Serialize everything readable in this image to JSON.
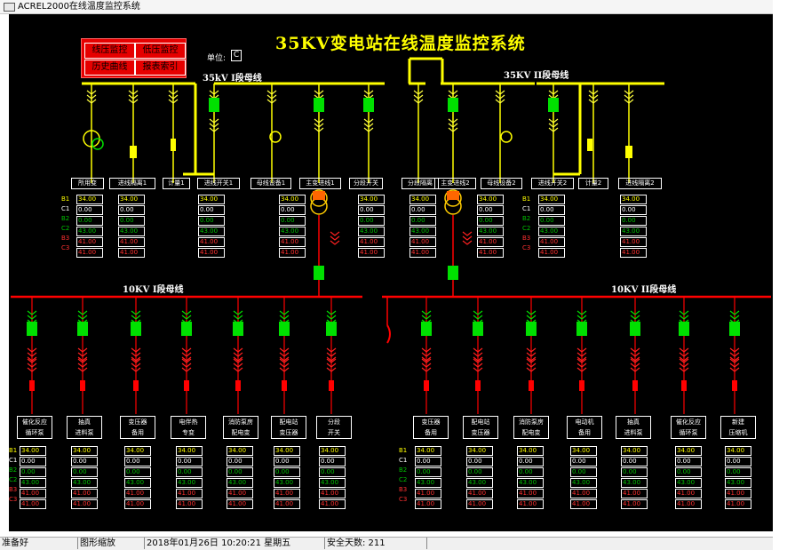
{
  "window": {
    "title": "ACREL2000在线温度监控系统"
  },
  "header": {
    "title": "35KV变电站在线温度监控系统",
    "unit_label": "单位:",
    "unit_value": "C",
    "buttons": [
      "线压监控",
      "低压监控",
      "历史曲线",
      "报表索引"
    ]
  },
  "buses": {
    "hv1": "35kV I段母线",
    "hv2": "35KV II段母线",
    "lv1": "10KV I段母线",
    "lv2": "10KV II段母线"
  },
  "hv_feeders": [
    "所用变",
    "进线隔离1",
    "计量1",
    "进线开关1",
    "母线设备1",
    "主变进线1",
    "分段开关",
    "分段隔离",
    "主变进线2",
    "母线设备2",
    "进线开关2",
    "计量2",
    "进线隔离2"
  ],
  "lv_feeders": [
    [
      "催化反应",
      "循环泵"
    ],
    [
      "抽真",
      "进料泵"
    ],
    [
      "变压器",
      "备用"
    ],
    [
      "电伴热",
      "专变"
    ],
    [
      "消防泵房",
      "配电变"
    ],
    [
      "配电站",
      "变压器"
    ],
    [
      "分段",
      "开关"
    ],
    [
      "变压器",
      "备用"
    ],
    [
      "配电站",
      "变压器"
    ],
    [
      "消防泵房",
      "配电变"
    ],
    [
      "电动机",
      "备用"
    ],
    [
      "抽真",
      "进料泵"
    ],
    [
      "催化反应",
      "循环泵"
    ],
    [
      "新建",
      "压缩机"
    ]
  ],
  "row_labels": [
    "B1",
    "C1",
    "B2",
    "C2",
    "B3",
    "C3"
  ],
  "readings": [
    "34.00",
    "0.00",
    "0.00",
    "43.00",
    "41.00",
    "41.00"
  ],
  "readings_hv": {
    "col2": [
      "34.00",
      "0.00",
      "0.00",
      "43.00",
      "41.00",
      "41.00"
    ],
    "col3": [
      "34.00",
      "0.00",
      "0.00",
      "43.00",
      "41.00",
      "41.00"
    ],
    "col5": [
      "34.00",
      "0.00",
      "0.00",
      "43.00",
      "41.00",
      "41.00"
    ]
  },
  "status": {
    "ready": "准备好",
    "zoom": "图形缩放",
    "datetime": "2018年01月26日   10:20:21   星期五",
    "safe_days": "安全天数: 211"
  },
  "colors": {
    "hv": "#ffff00",
    "lv": "#ff0000",
    "breaker": "#00e000",
    "reading_b1": "#ffff00",
    "reading_c1": "#ffffff",
    "reading_green": "#00c000",
    "reading_red": "#ff3030",
    "ct_hv": "#ffff40",
    "ct_lv": "#ff2020"
  }
}
